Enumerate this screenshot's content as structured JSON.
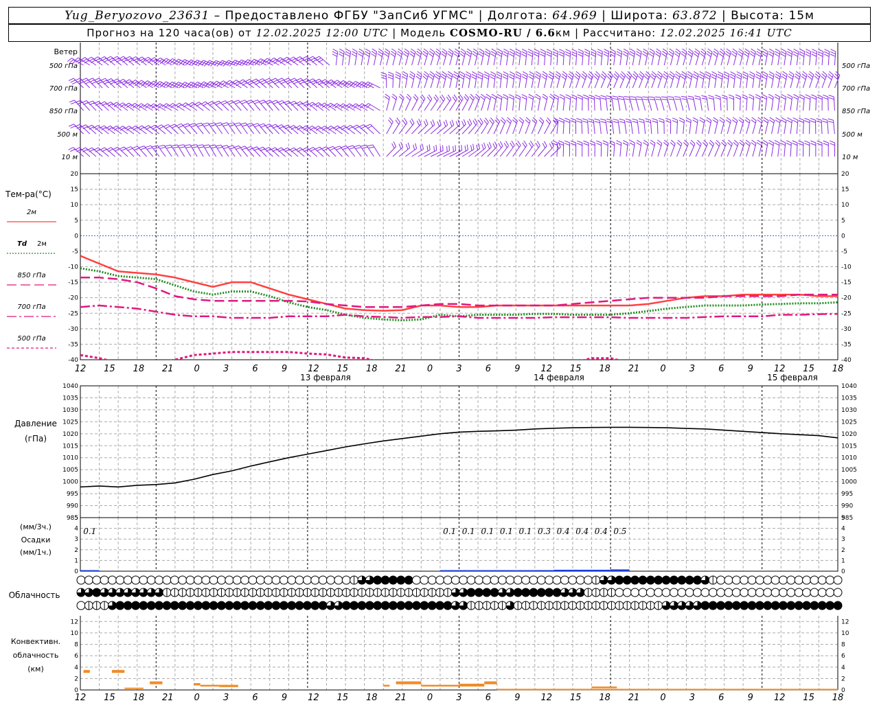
{
  "header": {
    "station": "Yug_Beryozovo_23631",
    "provided_by": " – Предоставлено ФГБУ \"ЗапСиб УГМС\"",
    "lon_label": "Долгота:",
    "lon_value": "64.969",
    "lat_label": "Широта:",
    "lat_value": "63.872",
    "alt_label": "Высота:",
    "alt_value": "15м",
    "forecast_label": "Прогноз на 120 часа(ов) от",
    "forecast_start": "12.02.2025 12:00 UTC",
    "model_label": "Модель",
    "model_name": "COSMO-RU / 6.6",
    "model_unit": "км",
    "computed_label": "Рассчитано:",
    "computed_value": "12.02.2025 16:41 UTC"
  },
  "colors": {
    "wind": "#8a2be2",
    "t2m": "#ff4040",
    "td2m": "#228b22",
    "t850": "#e0187f",
    "t700": "#e0187f",
    "t500": "#e0187f",
    "zero_line": "#3355ff",
    "pressure": "#000000",
    "precip": "#1a3fd6",
    "convective": "#f08c28",
    "grid": "#aaaaaa"
  },
  "x_axis": {
    "hour_labels": [
      "12",
      "15",
      "18",
      "21",
      "0",
      "3",
      "6",
      "9",
      "12",
      "15",
      "18",
      "21",
      "0",
      "3",
      "6",
      "9",
      "12",
      "15",
      "18",
      "21",
      "0",
      "3",
      "6",
      "9",
      "12",
      "15",
      "18"
    ],
    "date_labels": [
      "13 февраля",
      "14 февраля",
      "15 февраля"
    ]
  },
  "wind_panel": {
    "title": "Ветер",
    "levels": [
      "500 гПа",
      "700 гПа",
      "850 гПа",
      "500 м",
      "10 м"
    ],
    "right_levels": [
      "500 гПа",
      "700 гПа",
      "850 гПа",
      "500 м",
      "10 м"
    ]
  },
  "temp_panel": {
    "title": "Тем-ра(°С)",
    "legend": [
      {
        "name": "2м",
        "style": "solid",
        "color": "#ff4040"
      },
      {
        "name_prefix": "Td",
        "name": "2м",
        "style": "dotted",
        "color": "#228b22"
      },
      {
        "name": "850 гПа",
        "style": "dashed",
        "color": "#e0187f"
      },
      {
        "name": "700 гПа",
        "style": "dashdot",
        "color": "#e0187f"
      },
      {
        "name": "500 гПа",
        "style": "short-dashed",
        "color": "#e0187f"
      }
    ]
  },
  "pressure_panel": {
    "title": "Давление",
    "unit": "(гПа)"
  },
  "precip_panel": {
    "unit_3h": "(мм/3ч.)",
    "title": "Осадки",
    "unit_1h": "(мм/1ч.)",
    "values_3h_labels": [
      {
        "hour": 3,
        "label": "0.1"
      },
      {
        "hour": 60,
        "label": "0.1"
      },
      {
        "hour": 63,
        "label": "0.1"
      },
      {
        "hour": 66,
        "label": "0.1"
      },
      {
        "hour": 69,
        "label": "0.1"
      },
      {
        "hour": 72,
        "label": "0.1"
      },
      {
        "hour": 75,
        "label": "0.3"
      },
      {
        "hour": 78,
        "label": "0.4"
      },
      {
        "hour": 81,
        "label": "0.4"
      },
      {
        "hour": 84,
        "label": "0.4"
      },
      {
        "hour": 87,
        "label": "0.5"
      }
    ]
  },
  "cloud_panel": {
    "title": "Облачность",
    "rows": [
      "0000000000000000000000000000000000012233333000000000000000000000001223333333333321000000000000000000000000000000000000",
      "2232222222211111111111111111111111111111111111112233332233333322211110000000000000000000000000000000000000000000000",
      "0111233333333333333333333333333322333333333333332211111211111111111111111112222233333333333333333333333333333333333"
    ]
  },
  "conv_panel": {
    "title1": "Конвективн.",
    "title2": "облачность",
    "unit": "(км)"
  },
  "chart_data": [
    {
      "type": "line",
      "title": "Тем-ра(°С)",
      "ylim": [
        -40,
        20
      ],
      "x_hours": [
        0,
        3,
        6,
        9,
        12,
        15,
        18,
        21,
        24,
        27,
        30,
        33,
        36,
        39,
        42,
        45,
        48,
        51,
        54,
        57,
        60,
        63,
        66,
        69,
        72,
        75,
        78,
        81,
        84,
        87,
        90,
        93,
        96,
        99,
        102,
        105,
        108,
        111,
        114,
        117,
        120
      ],
      "series": [
        {
          "name": "2м",
          "values": [
            -6.5,
            -9,
            -11.5,
            -12,
            -12.5,
            -13.5,
            -15,
            -16.5,
            -15,
            -15,
            -17,
            -19,
            -20.5,
            -22,
            -23.5,
            -24,
            -24.2,
            -24,
            -22.5,
            -22.5,
            -23,
            -23,
            -22.5,
            -22.5,
            -22.5,
            -22.5,
            -22.5,
            -22.5,
            -22.5,
            -22.5,
            -22,
            -21,
            -20,
            -19.5,
            -19.5,
            -19,
            -19,
            -19,
            -19,
            -19.5,
            -19.5
          ]
        },
        {
          "name": "Td 2м",
          "values": [
            -10.5,
            -11.5,
            -13,
            -13.5,
            -14,
            -16,
            -18,
            -19,
            -18,
            -18,
            -19.5,
            -21.5,
            -23,
            -24,
            -25.5,
            -26.5,
            -27,
            -27.3,
            -27,
            -25.5,
            -26,
            -25.5,
            -25.5,
            -25.5,
            -25.2,
            -25.2,
            -25.5,
            -25.5,
            -25.5,
            -25,
            -24.3,
            -23.5,
            -23,
            -22.5,
            -22.5,
            -22.5,
            -22.2,
            -22,
            -21.8,
            -21.8,
            -21.5
          ]
        },
        {
          "name": "850 гПа",
          "values": [
            -13.5,
            -13.5,
            -14,
            -15,
            -17,
            -19.5,
            -20.5,
            -21,
            -21,
            -21,
            -21,
            -21,
            -21.2,
            -22,
            -22.5,
            -23,
            -23,
            -23,
            -22.5,
            -22,
            -22,
            -22.5,
            -22.5,
            -22.5,
            -22.5,
            -22.5,
            -22,
            -21.5,
            -21,
            -20.5,
            -20,
            -20,
            -20,
            -20,
            -19.5,
            -19.5,
            -19.5,
            -19.5,
            -19,
            -19,
            -19
          ]
        },
        {
          "name": "700 гПа",
          "values": [
            -23,
            -22.5,
            -23,
            -23.5,
            -24.5,
            -25.5,
            -26,
            -26,
            -26.5,
            -26.5,
            -26.5,
            -26,
            -26,
            -26,
            -25.5,
            -26,
            -26.2,
            -26.5,
            -26.2,
            -26.2,
            -26,
            -26.5,
            -26.5,
            -26.5,
            -26.5,
            -26.3,
            -26.3,
            -26.3,
            -26.3,
            -26.5,
            -26.5,
            -26.5,
            -26.5,
            -26.2,
            -26,
            -26,
            -26,
            -25.5,
            -25.5,
            -25.3,
            -25.2
          ]
        },
        {
          "name": "500 гПа",
          "values": [
            -38.5,
            -39.5,
            -41,
            -41,
            -41,
            -40,
            -38.5,
            -38,
            -37.5,
            -37.5,
            -37.5,
            -37.5,
            -38,
            -38.3,
            -39.3,
            -39.5,
            -41,
            -41,
            -41,
            -41,
            -41,
            -41,
            -41,
            -41,
            -41,
            -41,
            -41,
            -39.5,
            -39.5,
            -41,
            -41,
            -41,
            -41,
            -41,
            -41,
            -41,
            -41,
            -41,
            -41,
            -41,
            -41
          ]
        }
      ]
    },
    {
      "type": "line",
      "title": "Давление",
      "ylabel": "(гПа)",
      "ylim": [
        985,
        1040
      ],
      "x_hours": [
        0,
        3,
        6,
        9,
        12,
        15,
        18,
        21,
        24,
        27,
        30,
        33,
        36,
        39,
        42,
        45,
        48,
        51,
        54,
        57,
        60,
        63,
        66,
        69,
        72,
        75,
        78,
        81,
        84,
        87,
        90,
        93,
        96,
        99,
        102,
        105,
        108,
        111,
        114,
        117,
        120
      ],
      "series": [
        {
          "name": "Давление",
          "values": [
            997.8,
            998.2,
            997.8,
            998.5,
            998.8,
            999.5,
            1001,
            1003,
            1004.5,
            1006.5,
            1008.3,
            1010,
            1011.5,
            1013,
            1014.5,
            1015.8,
            1017,
            1018,
            1019,
            1020,
            1020.7,
            1021,
            1021.2,
            1021.5,
            1022,
            1022.3,
            1022.5,
            1022.6,
            1022.7,
            1022.7,
            1022.6,
            1022.5,
            1022.2,
            1022,
            1021.5,
            1021,
            1020.5,
            1020,
            1019.6,
            1019.2,
            1018.3
          ]
        }
      ]
    },
    {
      "type": "bar",
      "title": "Осадки",
      "ylim": [
        0,
        5
      ],
      "x_hours": [
        3,
        60,
        63,
        66,
        69,
        72,
        75,
        78,
        81,
        84,
        87
      ],
      "series": [
        {
          "name": "мм/3ч",
          "values": [
            0.1,
            0.1,
            0.1,
            0.1,
            0.1,
            0.1,
            0.3,
            0.4,
            0.4,
            0.4,
            0.5
          ]
        }
      ]
    },
    {
      "type": "bar",
      "title": "Конвективн. облачность",
      "ylim": [
        0,
        13
      ],
      "segments": [
        {
          "from": 0.5,
          "to": 1.5,
          "base": 3,
          "top": 3.5
        },
        {
          "from": 5,
          "to": 7,
          "base": 3,
          "top": 3.5
        },
        {
          "from": 7,
          "to": 10,
          "base": 0.2,
          "top": 0.4
        },
        {
          "from": 11,
          "to": 13,
          "base": 1,
          "top": 1.5
        },
        {
          "from": 18,
          "to": 19,
          "base": 0.8,
          "top": 1.2
        },
        {
          "from": 19,
          "to": 22,
          "base": 0.6,
          "top": 0.9
        },
        {
          "from": 22,
          "to": 25,
          "base": 0.5,
          "top": 0.9
        },
        {
          "from": 48,
          "to": 49,
          "base": 0.6,
          "top": 0.9
        },
        {
          "from": 50,
          "to": 54,
          "base": 1,
          "top": 1.5
        },
        {
          "from": 54,
          "to": 60,
          "base": 0.6,
          "top": 0.9
        },
        {
          "from": 60,
          "to": 64,
          "base": 0.6,
          "top": 1.1
        },
        {
          "from": 64,
          "to": 66,
          "base": 1,
          "top": 1.5
        },
        {
          "from": 66,
          "to": 120,
          "base": 0.05,
          "top": 0.2
        },
        {
          "from": 81,
          "to": 85,
          "base": 0.3,
          "top": 0.6
        }
      ]
    }
  ]
}
